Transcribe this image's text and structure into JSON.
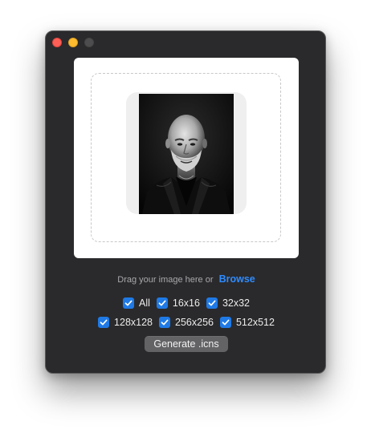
{
  "window": {
    "traffic_lights": [
      "close",
      "minimize",
      "zoom"
    ]
  },
  "drop_zone": {
    "instruction": "Drag your image here or",
    "browse_label": "Browse"
  },
  "sizes": {
    "row1": [
      {
        "label": "All",
        "checked": true
      },
      {
        "label": "16x16",
        "checked": true
      },
      {
        "label": "32x32",
        "checked": true
      }
    ],
    "row2": [
      {
        "label": "128x128",
        "checked": true
      },
      {
        "label": "256x256",
        "checked": true
      },
      {
        "label": "512x512",
        "checked": true
      }
    ]
  },
  "actions": {
    "generate_label": "Generate .icns"
  },
  "colors": {
    "window_bg": "#2a2a2c",
    "accent": "#1f7ae6",
    "link": "#2f8bff",
    "button_bg": "#636366"
  }
}
